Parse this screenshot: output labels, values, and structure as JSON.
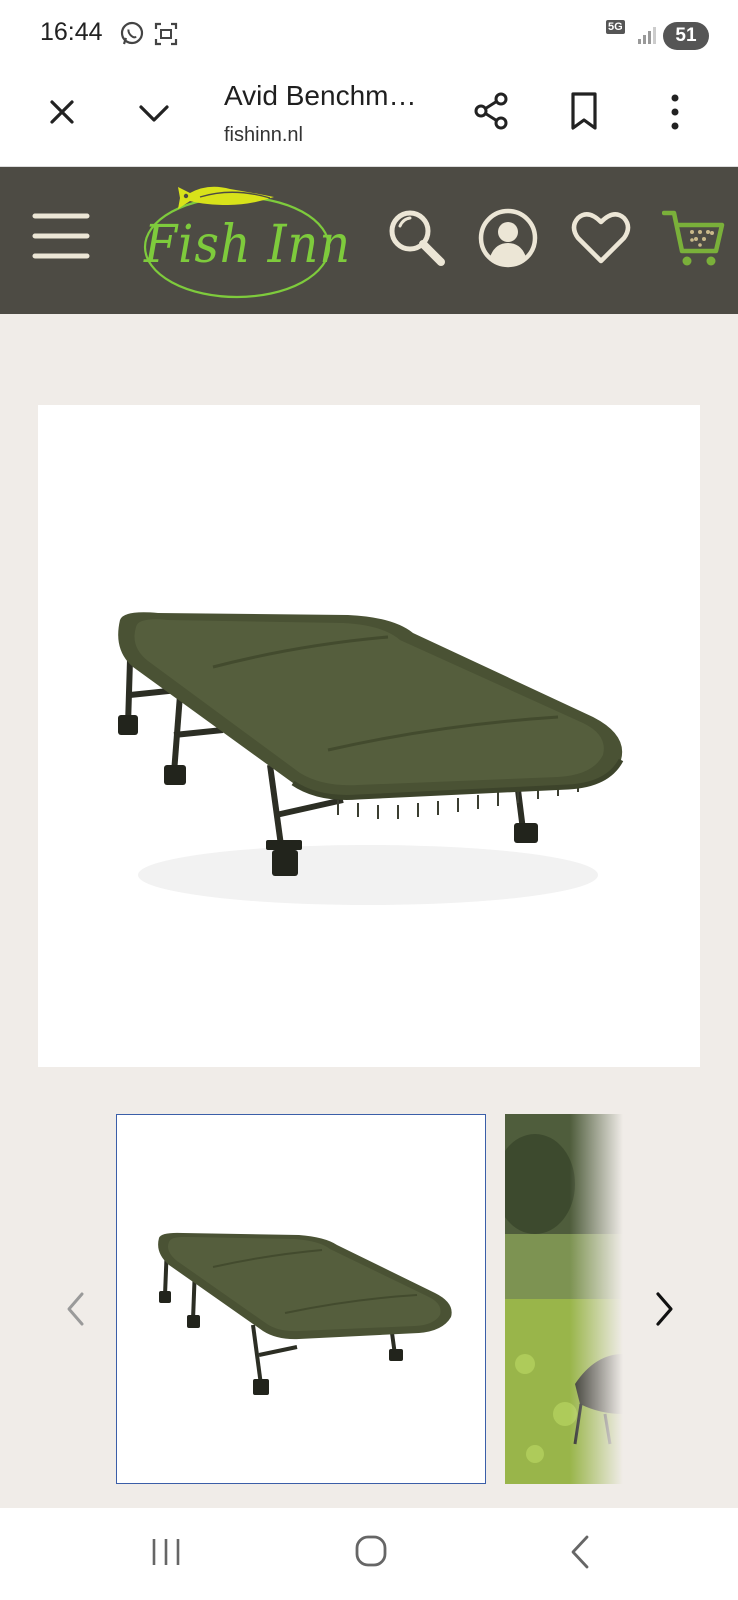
{
  "status_bar": {
    "time": "16:44",
    "network": "5G",
    "battery": "51",
    "icons": [
      "whatsapp-icon",
      "screenshot-icon",
      "signal-icon"
    ]
  },
  "tab_bar": {
    "title": "Avid Benchm…",
    "domain": "fishinn.nl",
    "icons": [
      "close-icon",
      "chevron-down-icon",
      "share-icon",
      "bookmark-icon",
      "more-vertical-icon"
    ]
  },
  "site_header": {
    "logo_text": "Fish Inn",
    "icons": [
      "hamburger-menu-icon",
      "search-icon",
      "account-icon",
      "heart-icon",
      "cart-icon"
    ],
    "colors": {
      "background": "#4d4b44",
      "logo_green": "#7ecb3c",
      "logo_fish": "#d8e21a"
    }
  },
  "gallery": {
    "thumbnail_count_visible": 2,
    "selected_index": 0,
    "icons": [
      "chevron-left-icon",
      "chevron-right-icon"
    ]
  },
  "system_nav": {
    "icons": [
      "recent-apps-icon",
      "home-icon",
      "back-icon"
    ]
  }
}
